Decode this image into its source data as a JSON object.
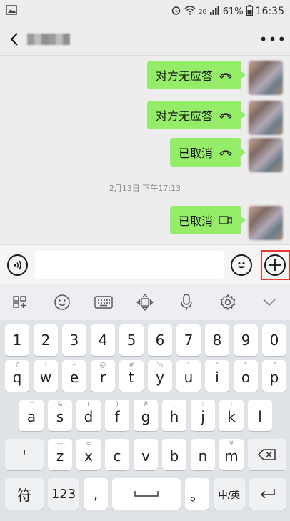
{
  "status_bar": {
    "signal_label": "2G",
    "battery": "61%",
    "time": "16:35"
  },
  "messages": [
    {
      "text": "对方无应答",
      "icon": "phone-hangup-icon"
    },
    {
      "text": "对方无应答",
      "icon": "phone-hangup-icon"
    },
    {
      "text": "已取消",
      "icon": "phone-hangup-icon"
    },
    {
      "text": "已取消",
      "icon": "video-call-icon"
    }
  ],
  "timestamp": "2月13日 下午17:13",
  "colors": {
    "bubble": "#95ec69",
    "highlight": "#e53935",
    "background": "#ededed"
  },
  "keyboard": {
    "numbers": [
      "1",
      "2",
      "3",
      "4",
      "5",
      "6",
      "7",
      "8",
      "9",
      "0"
    ],
    "row1": [
      {
        "sub": "?",
        "key": "q"
      },
      {
        "sub": "!",
        "key": "w"
      },
      {
        "sub": "~",
        "key": "e"
      },
      {
        "sub": "@",
        "key": "r"
      },
      {
        "sub": "#",
        "key": "t"
      },
      {
        "sub": "%",
        "key": "y"
      },
      {
        "sub": "\"",
        "key": "u"
      },
      {
        "sub": "\"",
        "key": "i"
      },
      {
        "sub": "*",
        "key": "o"
      },
      {
        "sub": "?",
        "key": "p"
      }
    ],
    "row2": [
      {
        "sub": "^",
        "key": "a"
      },
      {
        "sub": "&",
        "key": "s"
      },
      {
        "sub": "(",
        "key": "d"
      },
      {
        "sub": ")",
        "key": "f"
      },
      {
        "sub": "#",
        "key": "g"
      },
      {
        "sub": "_",
        "key": "h"
      },
      {
        "sub": ":",
        "key": "j"
      },
      {
        "sub": ";",
        "key": "k"
      },
      {
        "sub": "",
        "key": "l"
      }
    ],
    "row3": [
      {
        "sub": "—",
        "key": "z"
      },
      {
        "sub": "=",
        "key": "x"
      },
      {
        "sub": "",
        "key": "c"
      },
      {
        "sub": "",
        "key": "v"
      },
      {
        "sub": "",
        "key": "b"
      },
      {
        "sub": "",
        "key": "n"
      },
      {
        "sub": "¥",
        "key": "m"
      }
    ],
    "apostrophe": "'",
    "symbol_key": "符",
    "num_key": "123",
    "comma_key": ",",
    "period_key": "。",
    "lang_key": "中/英"
  }
}
